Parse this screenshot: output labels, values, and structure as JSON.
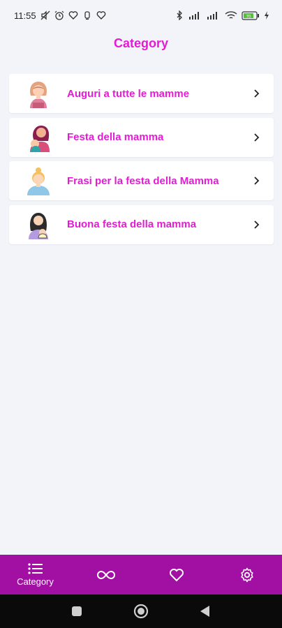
{
  "status_bar": {
    "time": "11:55",
    "battery_level": "70",
    "left_icons": [
      "mute-icon",
      "alarm-icon",
      "heart-icon",
      "bell-icon",
      "heart-icon"
    ],
    "right_icons": [
      "bluetooth-icon",
      "signal-icon",
      "signal-icon",
      "wifi-icon",
      "battery-icon",
      "charging-icon"
    ]
  },
  "header": {
    "title": "Category"
  },
  "categories": [
    {
      "label": "Auguri a tutte le mamme",
      "icon": "mother-avatar-icon"
    },
    {
      "label": "Festa della mamma",
      "icon": "mother-with-baby-icon"
    },
    {
      "label": "Frasi per la festa della Mamma",
      "icon": "woman-avatar-icon"
    },
    {
      "label": "Buona festa della mamma",
      "icon": "mother-holding-baby-icon"
    }
  ],
  "bottom_nav": {
    "items": [
      {
        "label": "Category",
        "icon": "list-icon"
      },
      {
        "label": "",
        "icon": "infinity-icon"
      },
      {
        "label": "",
        "icon": "heart-icon"
      },
      {
        "label": "",
        "icon": "gear-icon"
      }
    ]
  },
  "colors": {
    "accent": "#e31cd4",
    "nav_background": "#a20fa3",
    "page_background": "#f3f4f9"
  }
}
